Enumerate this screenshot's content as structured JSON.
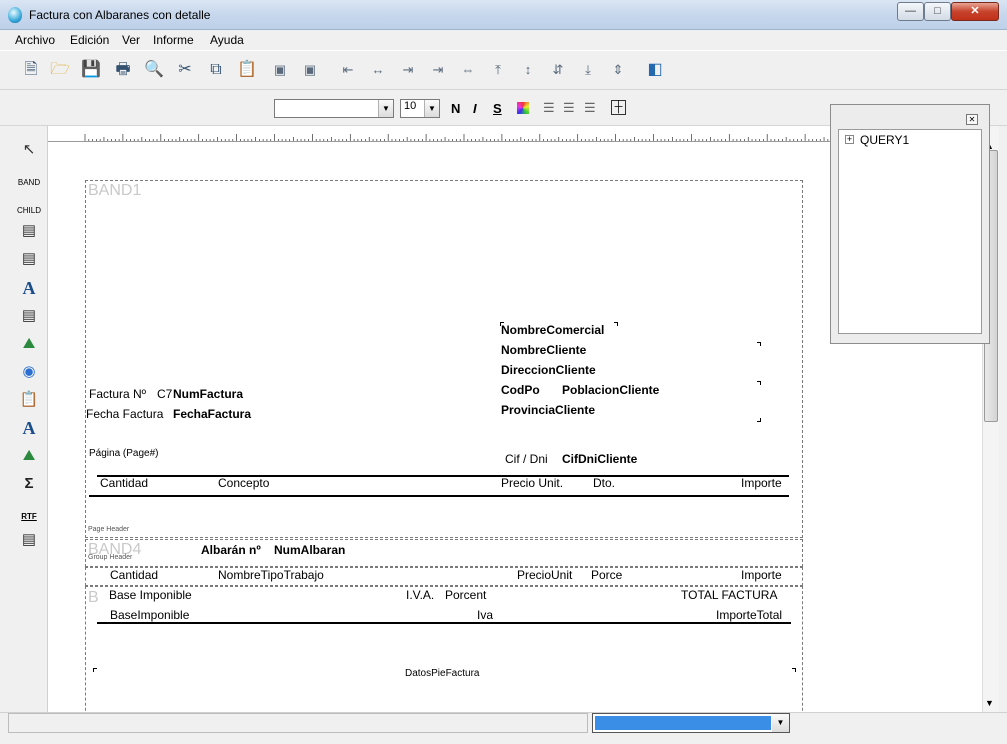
{
  "window": {
    "title": "Factura con Albaranes con detalle"
  },
  "menu": [
    "Archivo",
    "Edición",
    "Ver",
    "Informe",
    "Ayuda"
  ],
  "format_toolbar": {
    "font_name": "",
    "font_size": "10",
    "bold": "N",
    "italic": "I",
    "underline": "S"
  },
  "palette": {
    "band_label": "BAND",
    "child_label": "CHILD",
    "rtf_label": "RTF"
  },
  "tree": {
    "root": "QUERY1"
  },
  "report": {
    "band1_name": "BAND1",
    "band4_name": "BAND4",
    "band_b_name": "B",
    "factura_no_label": "Factura Nº",
    "serie_label": "C7",
    "num_factura": "NumFactura",
    "fecha_factura_label": "Fecha Factura",
    "fecha_factura": "FechaFactura",
    "nombre_comercial": "NombreComercial",
    "nombre_cliente": "NombreCliente",
    "direccion_cliente": "DireccionCliente",
    "cod_po": "CodPo",
    "poblacion_cliente": "PoblacionCliente",
    "provincia_cliente": "ProvinciaCliente",
    "pagina": "Página (Page#)",
    "cif_label": "Cif / Dni",
    "cif_value": "CifDniCliente",
    "hdr_cantidad": "Cantidad",
    "hdr_concepto": "Concepto",
    "hdr_precio": "Precio Unit.",
    "hdr_dto": "Dto.",
    "hdr_importe": "Importe",
    "page_header": "Page Header",
    "albaran_label": "Albarán nº",
    "num_albaran": "NumAlbaran",
    "group_header": "Group Header",
    "det_cantidad": "Cantidad",
    "det_nombre": "NombreTipoTrabajo",
    "det_precio": "PrecioUnit",
    "det_porce": "Porce",
    "det_importe": "Importe",
    "base_imponible_label": "Base Imponible",
    "iva_label": "I.V.A.",
    "porcentaje": "Porcent",
    "total_label": "TOTAL FACTURA",
    "base_imponible": "BaseImponible",
    "iva_value": "Iva",
    "importe_total": "ImporteTotal",
    "datos_pie": "DatosPieFactura"
  },
  "colors": {
    "accent": "#3a8ee6",
    "band_border": "#7a7a7a",
    "band_name": "#c9c9c9"
  }
}
